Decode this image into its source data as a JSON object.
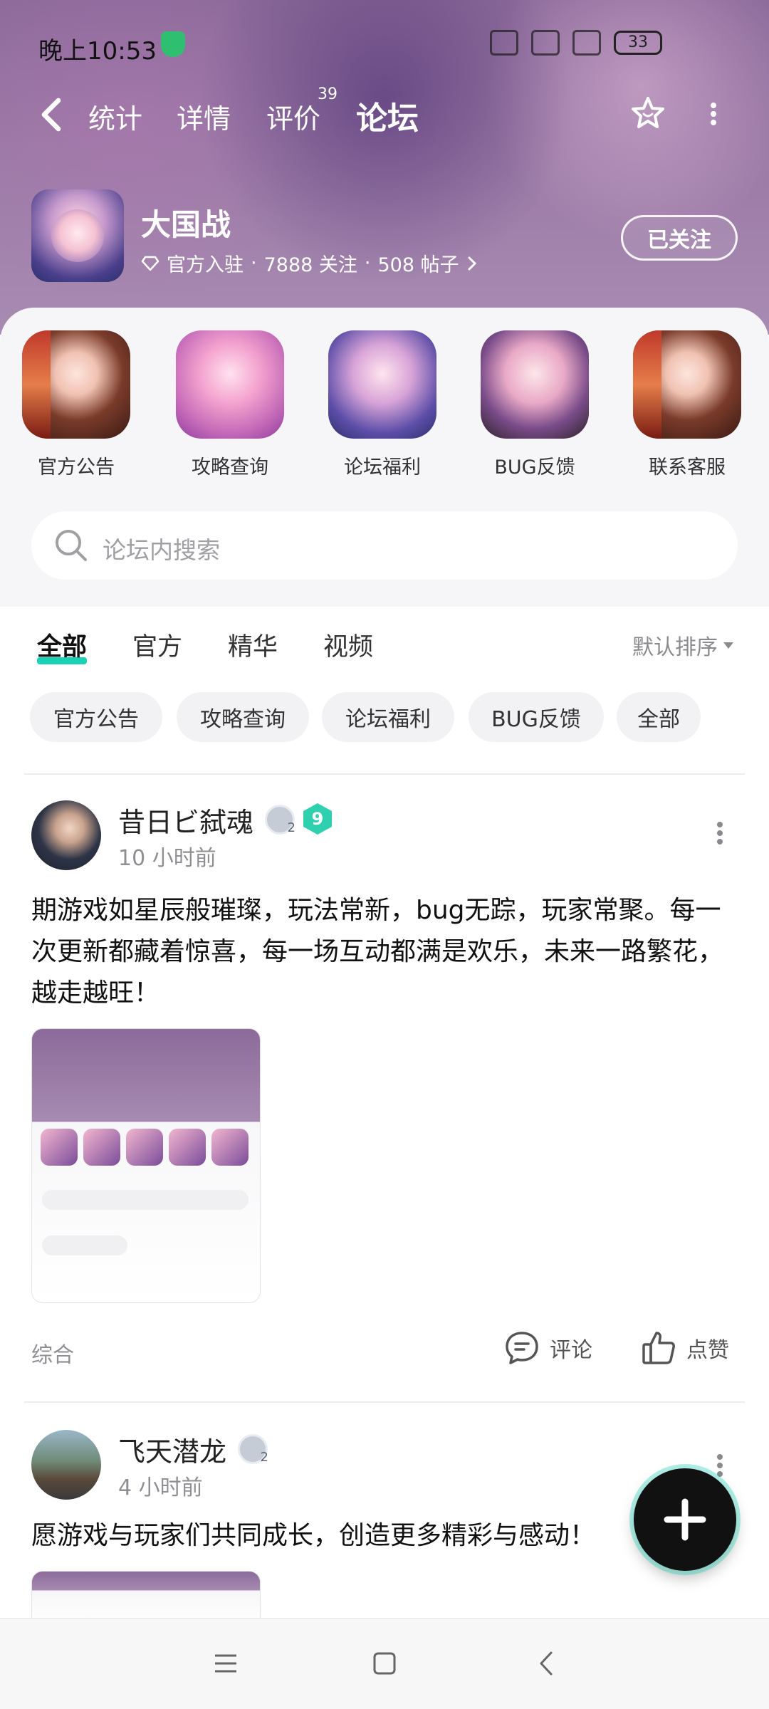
{
  "status": {
    "time": "晚上10:53",
    "battery": "33"
  },
  "nav": {
    "tabs": [
      "统计",
      "详情",
      "评价",
      "论坛"
    ],
    "review_count": "39",
    "active_tab": "论坛"
  },
  "game": {
    "title": "大国战",
    "official": "官方入驻",
    "followers": "7888 关注",
    "posts": "508 帖子",
    "follow_label": "已关注"
  },
  "shortcuts": [
    {
      "label": "官方公告",
      "icon": "official-announcement-icon"
    },
    {
      "label": "攻略查询",
      "icon": "guide-icon"
    },
    {
      "label": "论坛福利",
      "icon": "welfare-icon"
    },
    {
      "label": "BUG反馈",
      "icon": "bug-feedback-icon"
    },
    {
      "label": "联系客服",
      "icon": "customer-service-icon"
    }
  ],
  "search": {
    "placeholder": "论坛内搜索"
  },
  "filter_tabs": [
    "全部",
    "官方",
    "精华",
    "视频"
  ],
  "sort_label": "默认排序",
  "chips": [
    "官方公告",
    "攻略查询",
    "论坛福利",
    "BUG反馈",
    "全部"
  ],
  "posts": [
    {
      "user": "昔日ビ弑魂",
      "level": "2",
      "badge": "9",
      "time": "10 小时前",
      "body": "期游戏如星辰般璀璨，玩法常新，bug无踪，玩家常聚。每一次更新都藏着惊喜，每一场互动都满是欢乐，未来一路繁花，越走越旺！",
      "category": "综合",
      "comment_label": "评论",
      "like_label": "点赞"
    },
    {
      "user": "飞天潜龙",
      "level": "2",
      "time": "4 小时前",
      "body": "愿游戏与玩家们共同成长，创造更多精彩与感动！"
    }
  ],
  "colors": {
    "accent": "#19d2b5",
    "header": "#9b7aa6"
  }
}
